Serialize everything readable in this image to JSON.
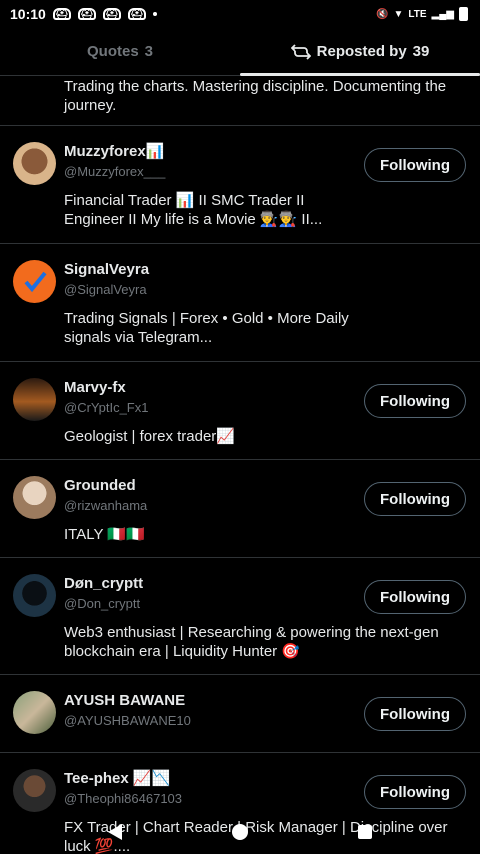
{
  "status_bar": {
    "time": "10:10",
    "signal_text": "LTE"
  },
  "tabs": [
    {
      "label": "Quotes",
      "count": "3",
      "active": false
    },
    {
      "label": "Reposted by",
      "count": "39",
      "active": true
    }
  ],
  "top_bio": "Trading the charts. Mastering discipline. Documenting the journey.",
  "users": [
    {
      "name": "Muzzyforex📊",
      "handle": "@Muzzyforex___",
      "bio": "Financial Trader 📊 II SMC Trader II Engineer II My life is a Movie 👨‍🏭👨‍🏭 II...",
      "button": "Following",
      "avatar_color": "#c49a6c"
    },
    {
      "name": "SignalVeyra",
      "handle": "@SignalVeyra",
      "bio": "Trading Signals | Forex • Gold • More Daily signals via Telegram...",
      "button": "",
      "avatar_color": "#f26b1d"
    },
    {
      "name": "Marvy-fx",
      "handle": "@CrYptIc_Fx1",
      "bio": "Geologist | forex trader📈",
      "button": "Following",
      "avatar_color": "#5a3a22"
    },
    {
      "name": "Grounded",
      "handle": "@rizwanhama",
      "bio": "ITALY 🇮🇹🇮🇹",
      "button": "Following",
      "avatar_color": "#b89a80"
    },
    {
      "name": "Døn_cryptt",
      "handle": "@Don_cryptt",
      "bio": "Web3 enthusiast | Researching & powering the next-gen blockchain era | Liquidity Hunter 🎯",
      "button": "Following",
      "avatar_color": "#1d3344"
    },
    {
      "name": "AYUSH BAWANE",
      "handle": "@AYUSHBAWANE10",
      "bio": "",
      "button": "Following",
      "avatar_color": "#6a7f5a"
    },
    {
      "name": "Tee-phex 📈📉",
      "handle": "@Theophi86467103",
      "bio": "FX Trader | Chart Reader | Risk Manager | Discipline over luck 💯....",
      "button": "Following",
      "avatar_color": "#2a2a2a"
    }
  ]
}
